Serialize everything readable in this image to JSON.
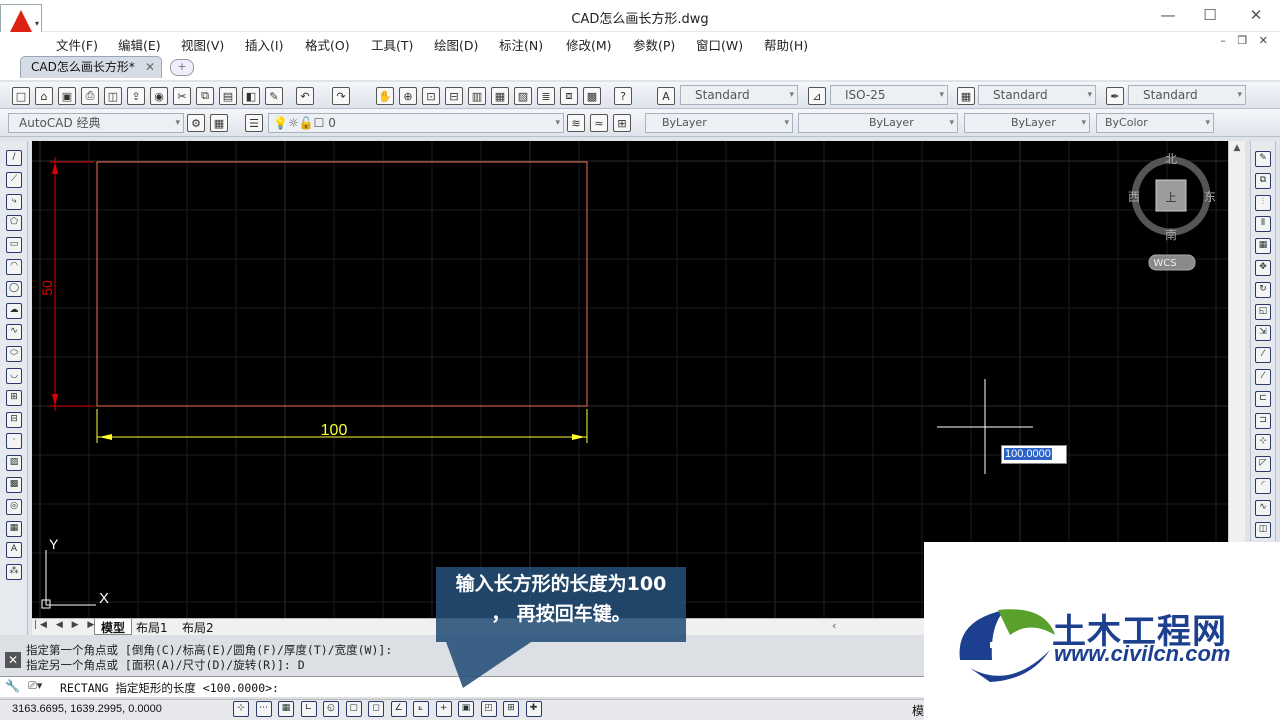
{
  "window": {
    "title": "CAD怎么画长方形.dwg",
    "minimize": "—",
    "maximize": "☐",
    "close": "✕"
  },
  "menu": [
    "文件(F)",
    "编辑(E)",
    "视图(V)",
    "插入(I)",
    "格式(O)",
    "工具(T)",
    "绘图(D)",
    "标注(N)",
    "修改(M)",
    "参数(P)",
    "窗口(W)",
    "帮助(H)"
  ],
  "doc_tab": {
    "label": "CAD怎么画长方形*",
    "close": "✕"
  },
  "styles_toolbar": {
    "text_style": "Standard",
    "dim_style": "ISO-25",
    "table_style": "Standard",
    "multileader_style": "Standard"
  },
  "workspace": {
    "name": "AutoCAD 经典",
    "layer": "0"
  },
  "properties": {
    "color": "ByLayer",
    "linetype": "ByLayer",
    "lineweight": "ByLayer",
    "plotstyle": "ByColor"
  },
  "viewcube": {
    "north": "北",
    "south": "南",
    "east": "东",
    "west": "西",
    "top_label": "上",
    "wcs": "WCS"
  },
  "drawing": {
    "width_dim": "100",
    "height_dim": "50",
    "dynamic_input": "100.0000",
    "ucs_y": "Y",
    "ucs_x": "X"
  },
  "layout_tabs": [
    "模型",
    "布局1",
    "布局2"
  ],
  "command_history": [
    "指定第一个角点或 [倒角(C)/标高(E)/圆角(F)/厚度(T)/宽度(W)]:",
    "指定另一个角点或 [面积(A)/尺寸(D)/旋转(R)]: D"
  ],
  "command_prompt": "RECTANG 指定矩形的长度 <100.0000>:",
  "status": {
    "coords": "3163.6695, 1639.2995, 0.0000",
    "model_label": "模"
  },
  "callout": {
    "line1": "输入长方形的长度为100",
    "line2": "， 再按回车键。"
  },
  "watermark": {
    "brand": "土木工程网",
    "url": "www.civilcn.com"
  },
  "colors": {
    "canvas": "#000000",
    "rect": "#f07050",
    "dim_red": "#e00000",
    "dim_yellow": "#ffff33",
    "callout": "#244e78",
    "watermark_blue": "#1d3f8f",
    "watermark_green": "#5aa02c"
  }
}
